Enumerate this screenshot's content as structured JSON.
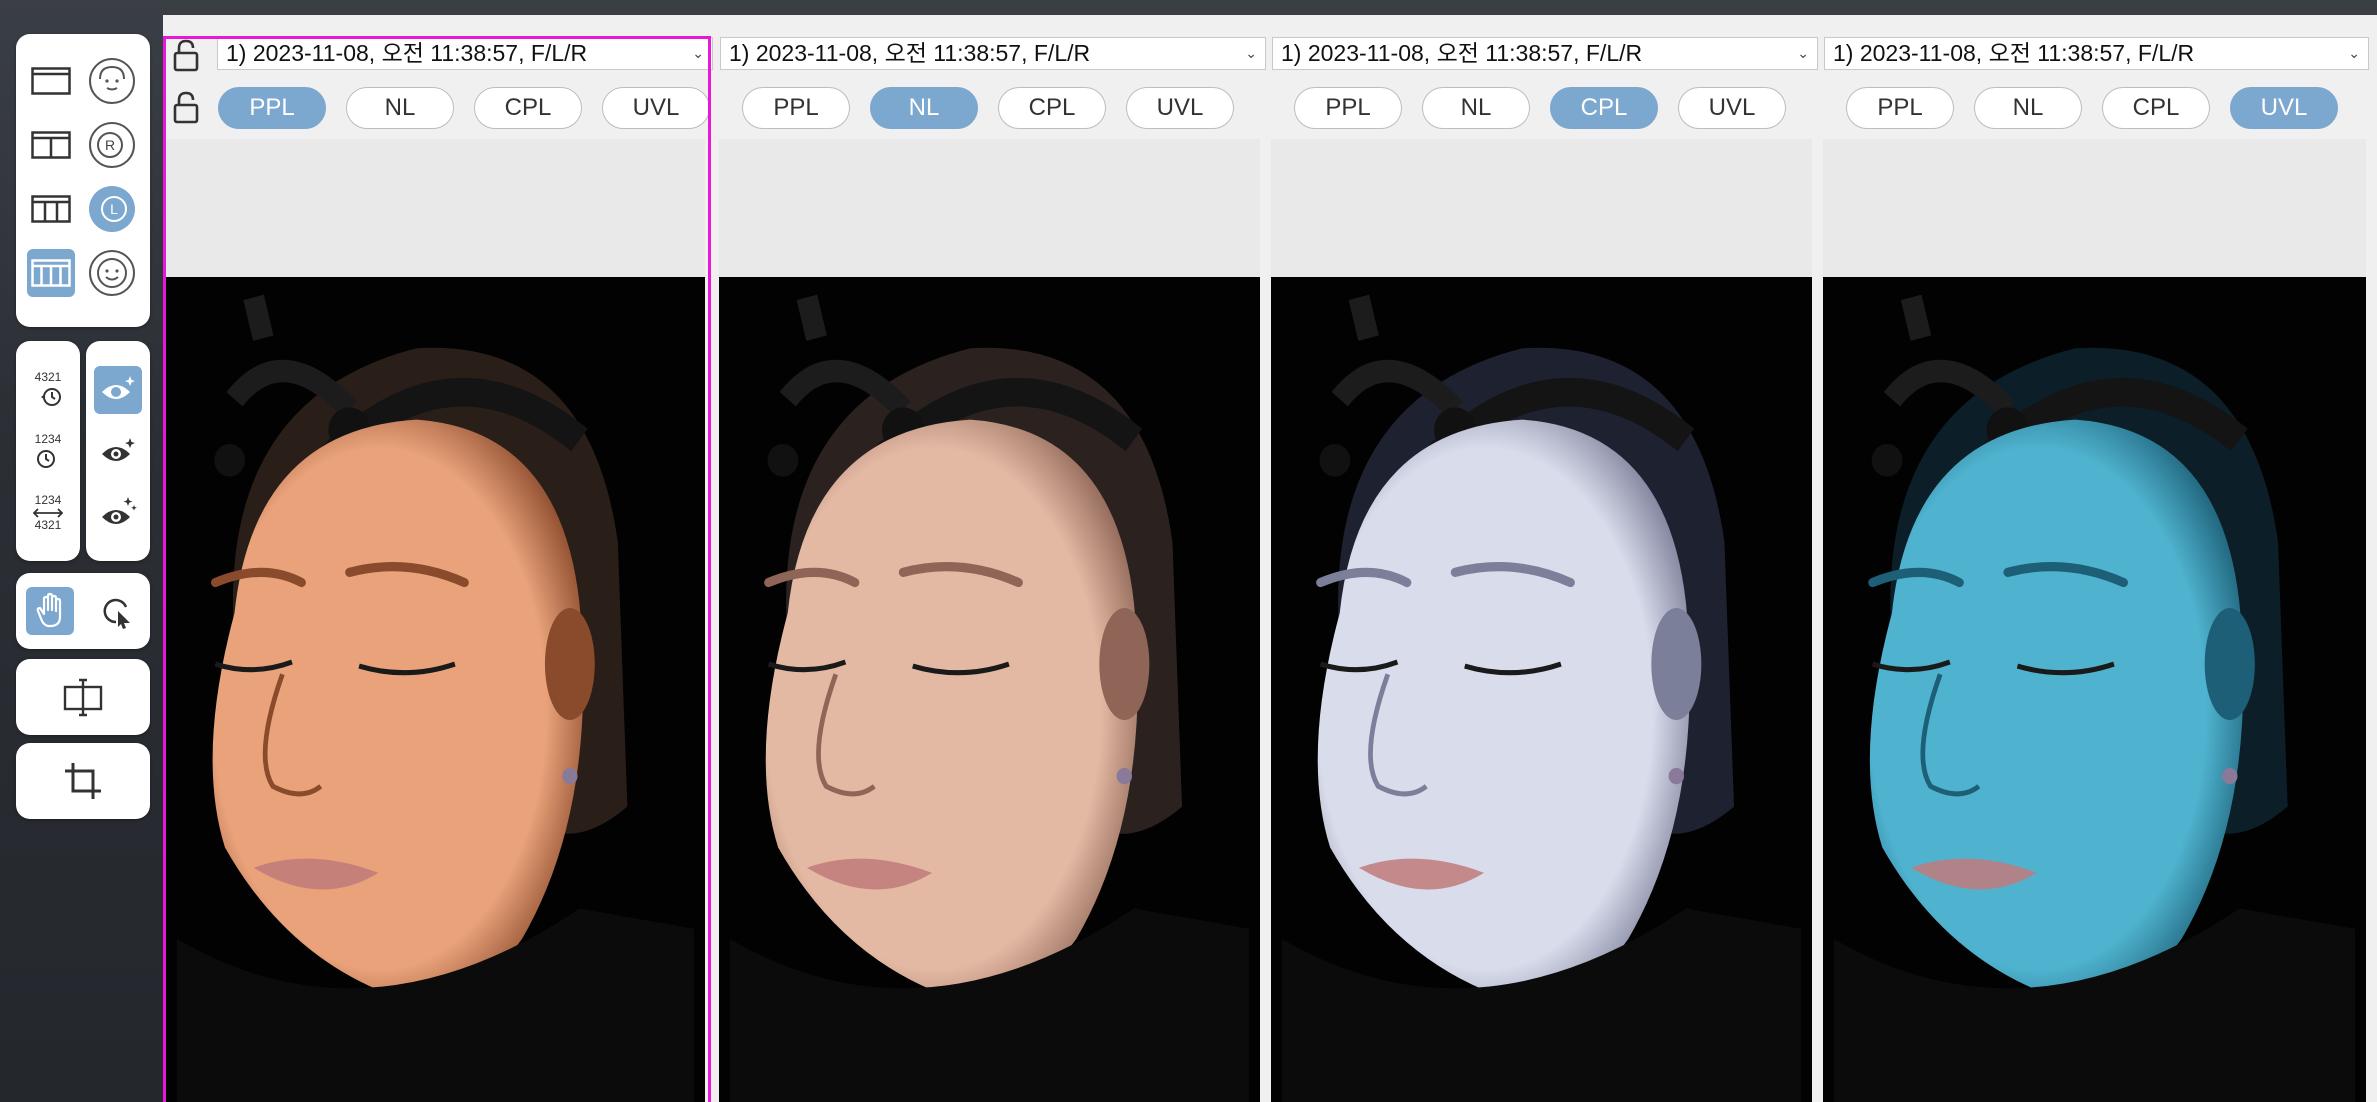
{
  "toolbar": {
    "layout_buttons": [
      {
        "name": "layout-single",
        "active": false
      },
      {
        "name": "layout-two-column",
        "active": false
      },
      {
        "name": "layout-three-column",
        "active": false
      },
      {
        "name": "layout-four-column",
        "active": true
      }
    ],
    "view_buttons": [
      {
        "name": "face-front-view",
        "active": false
      },
      {
        "name": "face-right-view",
        "label": "R",
        "active": false
      },
      {
        "name": "face-left-view",
        "label": "L",
        "active": true
      },
      {
        "name": "face-smile-view",
        "active": false
      }
    ],
    "order_buttons": [
      {
        "name": "order-descending",
        "label": "4321"
      },
      {
        "name": "order-ascending",
        "label": "1234"
      },
      {
        "name": "order-swap",
        "label_top": "1234",
        "label_bottom": "4321"
      }
    ],
    "eye_buttons": [
      {
        "name": "eye-sparkle-1",
        "active": true
      },
      {
        "name": "eye-sparkle-2",
        "active": false
      },
      {
        "name": "eye-sparkle-3",
        "active": false
      }
    ],
    "pan_tool_active": true
  },
  "panels": [
    {
      "date": "1) 2023-11-08, 오전 11:38:57, F/L/R",
      "active_mode": "PPL",
      "skin": "#e9a27a",
      "shade": "#8a4a2c",
      "hair": "#2a1e18",
      "tint": "warm"
    },
    {
      "date": "1) 2023-11-08, 오전 11:38:57, F/L/R",
      "active_mode": "NL",
      "skin": "#e4b9a4",
      "shade": "#8e6556",
      "hair": "#2b221f",
      "tint": "neutral"
    },
    {
      "date": "1) 2023-11-08, 오전 11:38:57, F/L/R",
      "active_mode": "CPL",
      "skin": "#d9dceb",
      "shade": "#7b7f99",
      "hair": "#1e2230",
      "tint": "cool"
    },
    {
      "date": "1) 2023-11-08, 오전 11:38:57, F/L/R",
      "active_mode": "UVL",
      "skin": "#4fb3cf",
      "shade": "#1d5f77",
      "hair": "#0c1e28",
      "tint": "uv"
    }
  ],
  "modes": [
    "PPL",
    "NL",
    "CPL",
    "UVL"
  ],
  "colors": {
    "accent": "#7ca7cf",
    "selection": "#e619d8"
  }
}
